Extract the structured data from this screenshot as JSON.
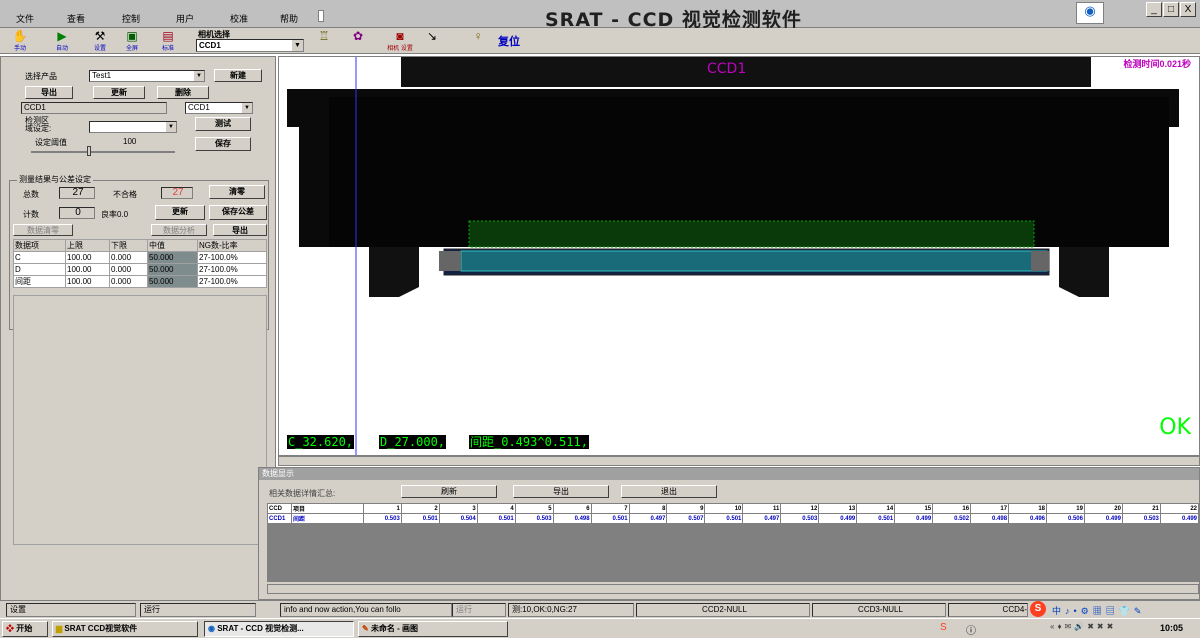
{
  "menu": [
    "文件",
    "查看",
    "控制",
    "用户",
    "校准",
    "帮助"
  ],
  "app_title": "SRAT - CCD 视觉检测软件",
  "window_buttons": [
    "_",
    "□",
    "X"
  ],
  "toolbar": {
    "buttons": [
      {
        "label": "手动",
        "icon": "hand-icon"
      },
      {
        "label": "自动",
        "icon": "play-icon"
      },
      {
        "label": "设置",
        "icon": "settings-icon"
      },
      {
        "label": "全屏",
        "icon": "fullscreen-icon"
      },
      {
        "label": "标准",
        "icon": "standard-icon"
      }
    ],
    "camera_select_label": "相机选择",
    "camera_select_value": "CCD1",
    "camera_settings_label": "相机\n设置",
    "reset_label": "复位"
  },
  "left": {
    "product_label": "选择产品",
    "product_value": "Test1",
    "new_btn": "新建",
    "export_btn": "导出",
    "update_btn": "更新",
    "delete_btn": "删除",
    "ccd_left": "CCD1",
    "ccd_right": "CCD1",
    "detect_area_label": "检测区\n域设定:",
    "test_btn": "测试",
    "save_btn": "保存",
    "threshold_label": "设定阈值",
    "threshold_value": "100",
    "results_group": "测量结果与公差设定",
    "total_label": "总数",
    "total_value": "27",
    "ng_label": "不合格",
    "ng_value": "27",
    "clear_btn": "清零",
    "count_label": "计数",
    "count_value": "0",
    "yield_label": "良率0.0",
    "update2_btn": "更新",
    "save_tol_btn": "保存公差",
    "data_clear_btn": "数据清零",
    "data_analysis_btn": "数据分析",
    "export2_btn": "导出",
    "table_headers": [
      "数据项",
      "上限",
      "下限",
      "中值",
      "NG数-比率"
    ],
    "table_rows": [
      [
        "C",
        "100.00",
        "0.000",
        "50.000",
        "27-100.0%"
      ],
      [
        "D",
        "100.00",
        "0.000",
        "50.000",
        "27-100.0%"
      ],
      [
        "间距",
        "100.00",
        "0.000",
        "50.000",
        "27-100.0%"
      ]
    ]
  },
  "image": {
    "ccd_label": "CCD1",
    "time_label": "检测时间0.021秒",
    "measurements": [
      "C_32.620,",
      "D_27.000,",
      "间距_0.493^0.511,"
    ],
    "result": "OK"
  },
  "data_panel": {
    "title": "数据显示",
    "summary_label": "相关数据详情汇总:",
    "refresh_btn": "刷新",
    "export_btn": "导出",
    "exit_btn": "退出",
    "head_cols": [
      "CCD",
      "项目",
      "1",
      "2",
      "3",
      "4",
      "5",
      "6",
      "7",
      "8",
      "9",
      "10",
      "11",
      "12",
      "13",
      "14",
      "15",
      "16",
      "17",
      "18",
      "19",
      "20",
      "21",
      "22"
    ],
    "row": [
      "CCD1",
      "间距",
      "0.503",
      "0.501",
      "0.504",
      "0.501",
      "0.503",
      "0.498",
      "0.501",
      "0.497",
      "0.507",
      "0.501",
      "0.497",
      "0.503",
      "0.499",
      "0.501",
      "0.499",
      "0.502",
      "0.498",
      "0.496",
      "0.506",
      "0.499",
      "0.503",
      "0.499"
    ]
  },
  "status": {
    "left": "设置",
    "left2": "运行",
    "info": "info and now action,You can follo",
    "run": "运行",
    "counts": "测:10,OK:0,NG:27",
    "ccd2": "CCD2-NULL",
    "ccd3": "CCD3-NULL",
    "ccd4": "CCD4-"
  },
  "taskbar": {
    "start": "开始",
    "task1": "SRAT CCD视觉软件",
    "task2": "SRAT - CCD 视觉检测...",
    "task3": "未命名 - 画图",
    "clock": "10:05"
  }
}
